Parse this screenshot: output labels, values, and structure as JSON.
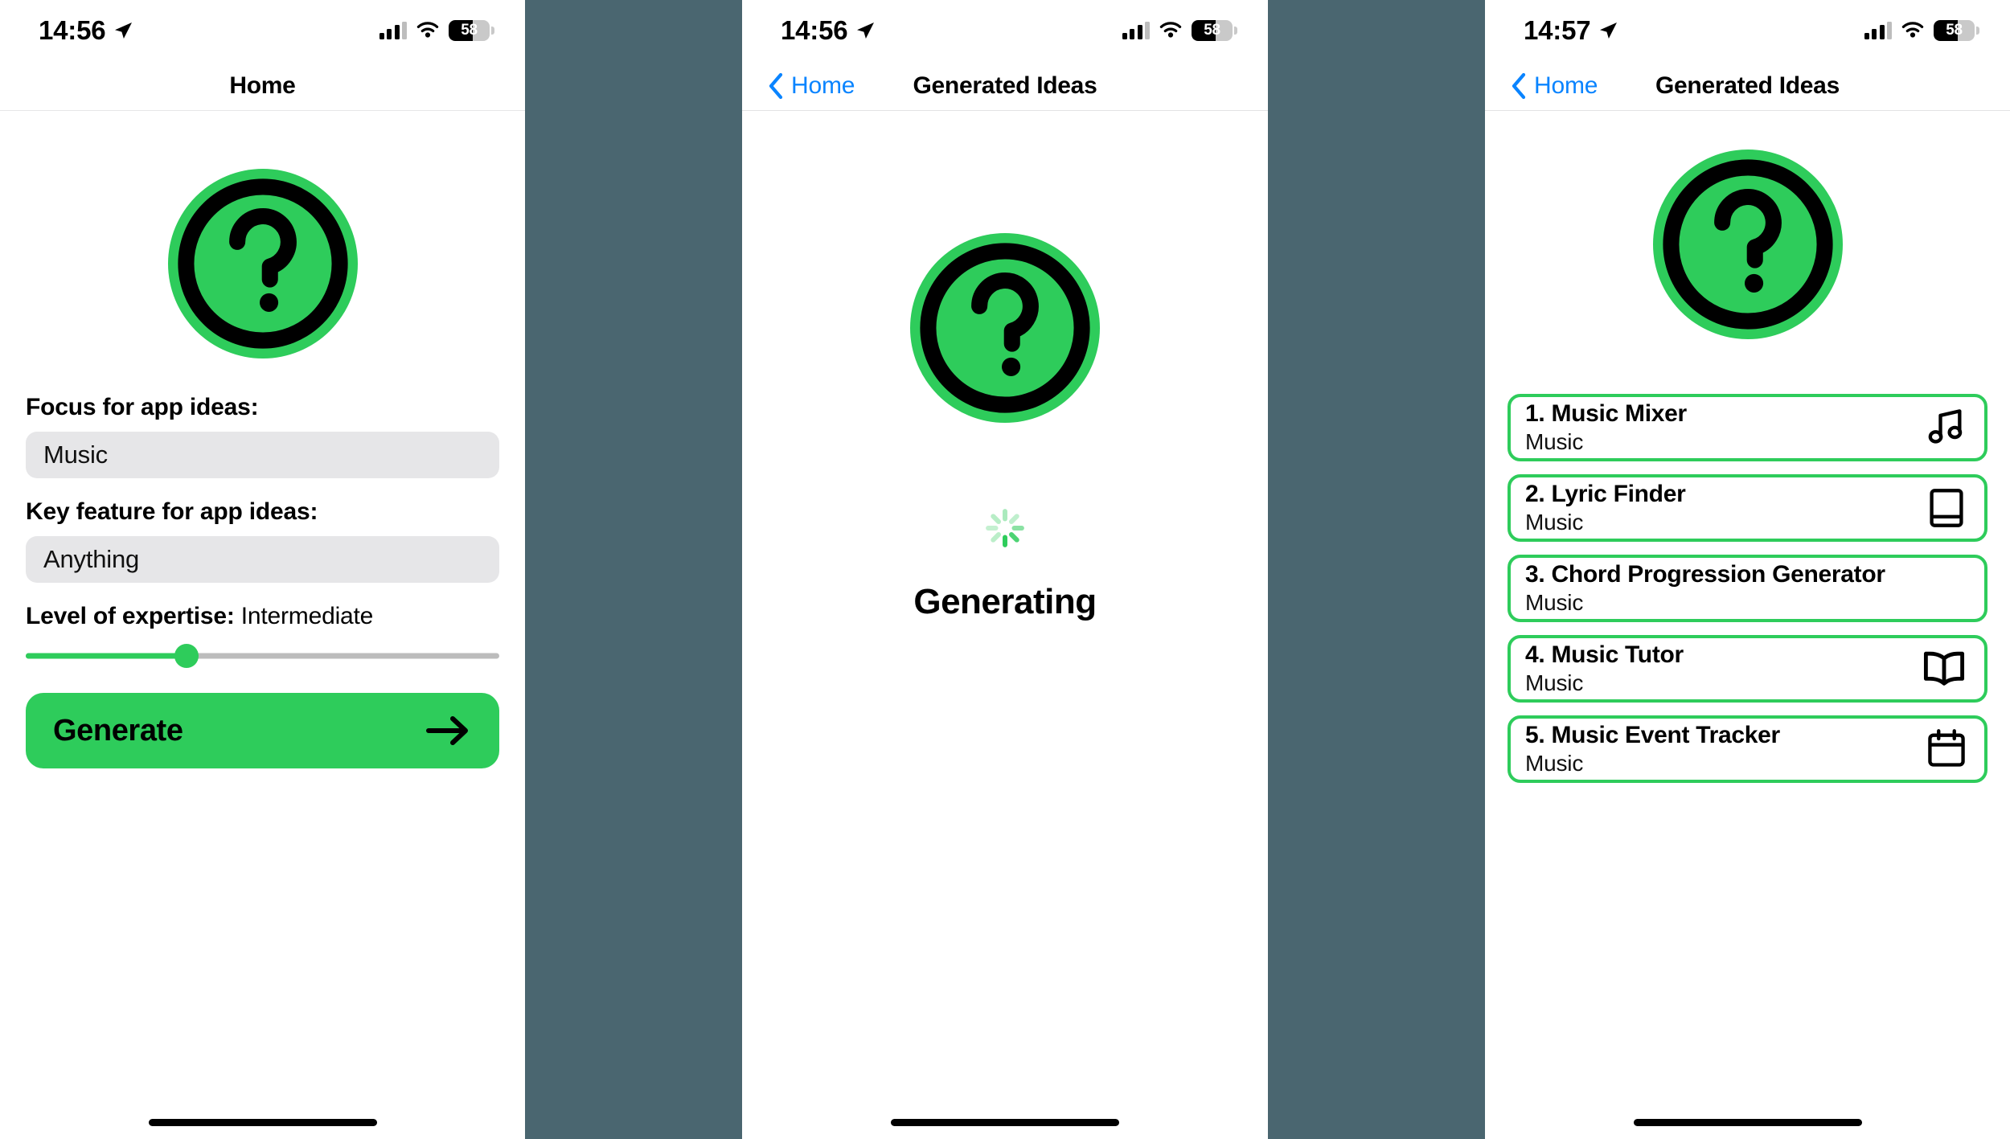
{
  "theme": {
    "green": "#2ecc5b",
    "blue": "#0a84ff",
    "slate_gap": "#4a6670",
    "field_bg": "#e6e6e8",
    "track_grey": "#bcbcbc"
  },
  "panels": [
    {
      "status": {
        "time": "14:56",
        "location_icon": "location-arrow-icon",
        "cellular_icon": "cellular-bars-icon",
        "wifi_icon": "wifi-icon",
        "battery_icon": "battery-icon",
        "battery_percent": "58"
      },
      "nav": {
        "title": "Home",
        "back_label": null
      },
      "logo": {
        "icon": "question-mark-circle-icon"
      },
      "form": {
        "focus_label": "Focus for app ideas:",
        "focus_value": "Music",
        "feature_label": "Key feature for app ideas:",
        "feature_value": "Anything",
        "expertise_label": "Level of expertise:",
        "expertise_value": "Intermediate",
        "slider_position_percent": 34,
        "generate_label": "Generate",
        "generate_icon": "arrow-right-icon"
      }
    },
    {
      "status": {
        "time": "14:56",
        "location_icon": "location-arrow-icon",
        "cellular_icon": "cellular-bars-icon",
        "wifi_icon": "wifi-icon",
        "battery_icon": "battery-icon",
        "battery_percent": "58"
      },
      "nav": {
        "title": "Generated Ideas",
        "back_label": "Home",
        "back_icon": "chevron-left-icon"
      },
      "logo": {
        "icon": "question-mark-circle-icon"
      },
      "loading": {
        "spinner_icon": "loading-spinner-icon",
        "status_text": "Generating"
      }
    },
    {
      "status": {
        "time": "14:57",
        "location_icon": "location-arrow-icon",
        "cellular_icon": "cellular-bars-icon",
        "wifi_icon": "wifi-icon",
        "battery_icon": "battery-icon",
        "battery_percent": "58"
      },
      "nav": {
        "title": "Generated Ideas",
        "back_label": "Home",
        "back_icon": "chevron-left-icon"
      },
      "logo": {
        "icon": "question-mark-circle-icon"
      },
      "ideas": [
        {
          "title": "1. Music Mixer",
          "subtitle": "Music",
          "icon": "music-note-icon"
        },
        {
          "title": "2. Lyric Finder",
          "subtitle": "Music",
          "icon": "book-closed-icon"
        },
        {
          "title": "3. Chord Progression Generator",
          "subtitle": "Music",
          "icon": "none"
        },
        {
          "title": "4. Music Tutor",
          "subtitle": "Music",
          "icon": "book-open-icon"
        },
        {
          "title": "5. Music Event Tracker",
          "subtitle": "Music",
          "icon": "calendar-icon"
        }
      ]
    }
  ]
}
